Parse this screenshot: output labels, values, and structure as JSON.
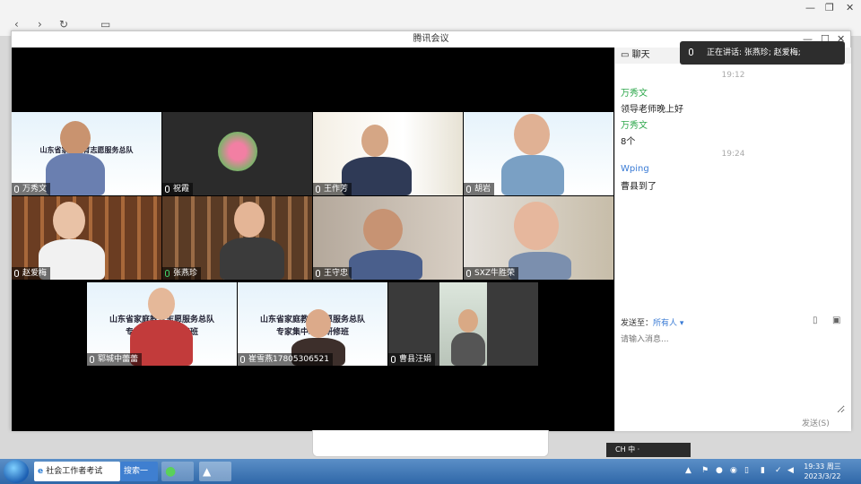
{
  "window": {
    "title": "腾讯会议"
  },
  "chat": {
    "header": "聊天",
    "speaking_label": "正在讲话: 张燕珍; 赵爱梅;",
    "messages": [
      {
        "time": "19:12"
      },
      {
        "sender": "万秀文",
        "text": "领导老师晚上好"
      },
      {
        "sender": "万秀文",
        "text": "8个"
      },
      {
        "time": "19:24"
      },
      {
        "sender": "Wping",
        "text": "曹县到了"
      }
    ],
    "send_to_label": "发送至：",
    "send_to_value": "所有人 ▾",
    "input_placeholder": "请输入消息...",
    "send_button": "发送(S)"
  },
  "participants": [
    {
      "name": "万秀文",
      "mic": "on"
    },
    {
      "name": "祝霞",
      "mic": "on"
    },
    {
      "name": "王作芳",
      "mic": "on"
    },
    {
      "name": "胡岩",
      "mic": "off"
    },
    {
      "name": "赵爱梅",
      "mic": "off"
    },
    {
      "name": "张燕珍",
      "mic": "active"
    },
    {
      "name": "王守忠",
      "mic": "off"
    },
    {
      "name": "SXZ牛胜荣",
      "mic": "off"
    },
    {
      "name": "郓城中蕾蕾",
      "mic": "off"
    },
    {
      "name": "崔雪燕17805306521",
      "mic": "off"
    },
    {
      "name": "曹县汪娟",
      "mic": "on"
    }
  ],
  "banners": {
    "b1": "山东省家庭教育志愿服务总队",
    "b2": "专家集中培训研修班"
  },
  "taskbar": {
    "items": [
      {
        "label": "社会工作者考试"
      },
      {
        "label": "搜索一下"
      }
    ],
    "ime": "CH 中 ·",
    "clock_time": "19:33 周三",
    "clock_date": "2023/3/22"
  },
  "colors": {
    "accent": "#3a7bd5",
    "sender_green": "#2ea84c",
    "active_mic": "#3fd36a"
  }
}
